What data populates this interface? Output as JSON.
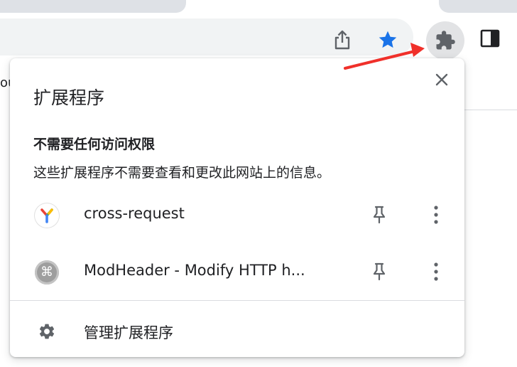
{
  "browser": {
    "page_partial_text": "ou",
    "toolbar": {
      "share_icon": "share-icon",
      "bookmark_icon": "star-icon",
      "extensions_icon": "puzzle-icon",
      "side_panel_icon": "side-panel-icon",
      "star_color": "#1a73e8"
    }
  },
  "popup": {
    "title": "扩展程序",
    "section": {
      "heading": "不需要任何访问权限",
      "description": "这些扩展程序不需要查看和更改此网站上的信息。"
    },
    "extensions": [
      {
        "name": "cross-request",
        "icon": "y-logo-icon"
      },
      {
        "name": "ModHeader - Modify HTTP h...",
        "icon": "command-key-icon"
      }
    ],
    "manage_label": "管理扩展程序"
  },
  "colors": {
    "annotation_arrow": "#f0302a",
    "text": "#202124",
    "icon": "#5f6368"
  }
}
